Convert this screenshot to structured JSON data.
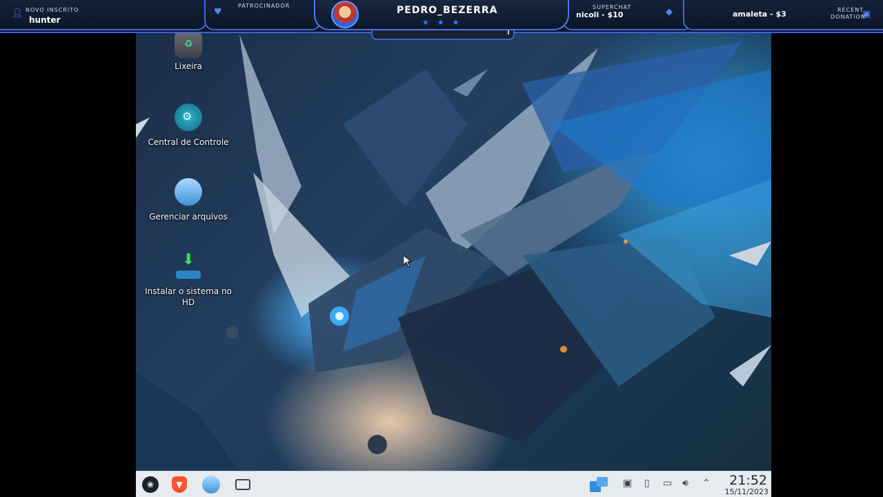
{
  "overlay": {
    "new_subscriber": {
      "label": "NOVO INSCRITO",
      "value": "hunter"
    },
    "sponsor": {
      "label": "PATROCINADOR"
    },
    "streamer": {
      "name": "PEDRO_BEZERRA",
      "stars": "★★★"
    },
    "superchat": {
      "label": "SUPERCHAT",
      "value": "nicoli - $10"
    },
    "donation": {
      "value": "amaleta - $3"
    },
    "recent_donation": {
      "label_line1": "RECENT",
      "label_line2": "DONATION"
    },
    "accent_color": "#3d6ae0"
  },
  "desktop": {
    "icons": [
      {
        "label": "Lixeira",
        "icon": "trash-icon"
      },
      {
        "label": "Central de Controle",
        "icon": "control-center-icon"
      },
      {
        "label": "Gerenciar arquivos",
        "icon": "folder-icon"
      },
      {
        "label": "Instalar o sistema no HD",
        "icon": "install-download-icon"
      }
    ]
  },
  "taskbar": {
    "apps": [
      "start-menu-icon",
      "brave-browser-icon",
      "file-manager-icon",
      "terminal-icon"
    ],
    "tray": [
      "window-switcher-icon",
      "display-icon",
      "usb-icon",
      "monitor-icon",
      "volume-icon",
      "chevron-up-icon"
    ],
    "clock": {
      "time": "21:52",
      "date": "15/11/2023"
    }
  }
}
